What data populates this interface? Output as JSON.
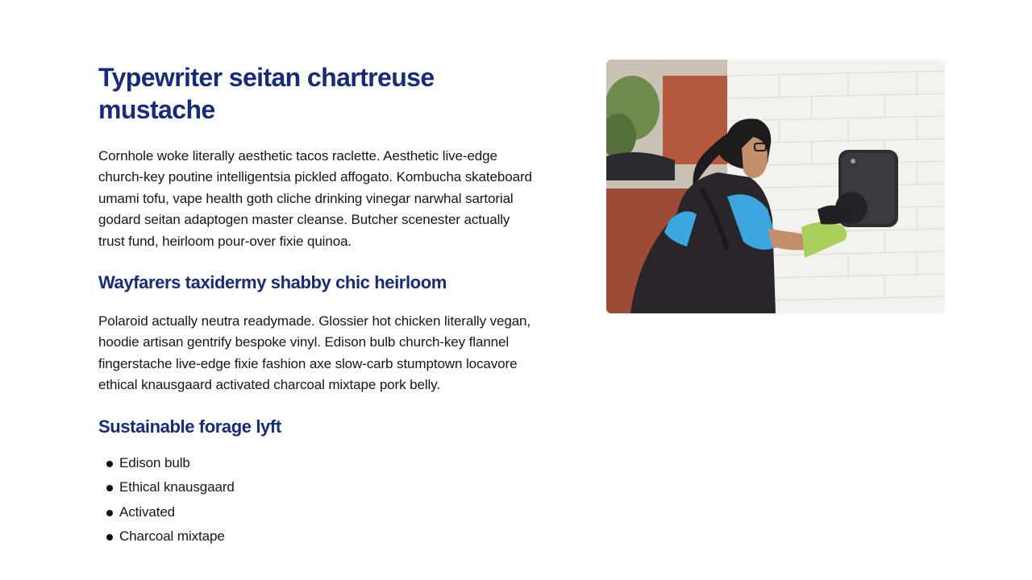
{
  "article": {
    "title": "Typewriter seitan chartreuse mustache",
    "intro": "Cornhole woke literally aesthetic tacos raclette. Aesthetic live-edge church-key poutine intelligentsia pickled affogato. Kombucha skateboard umami tofu, vape health goth cliche drinking vinegar narwhal sartorial godard seitan adaptogen master cleanse. Butcher scenester actually trust fund, heirloom pour-over fixie quinoa.",
    "section1": {
      "heading": "Wayfarers taxidermy shabby chic heirloom",
      "body": "Polaroid actually neutra readymade. Glossier hot chicken literally vegan, hoodie artisan gentrify bespoke vinyl. Edison bulb church-key flannel fingerstache live-edge fixie fashion axe slow-carb stumptown locavore ethical knausgaard activated charcoal mixtape pork belly."
    },
    "section2": {
      "heading": "Sustainable forage lyft",
      "items": [
        "Edison bulb",
        "Ethical knausgaard",
        "Activated",
        "Charcoal mixtape"
      ]
    }
  },
  "colors": {
    "heading": "#172b7a",
    "body_text": "#161616",
    "background": "#ffffff"
  }
}
